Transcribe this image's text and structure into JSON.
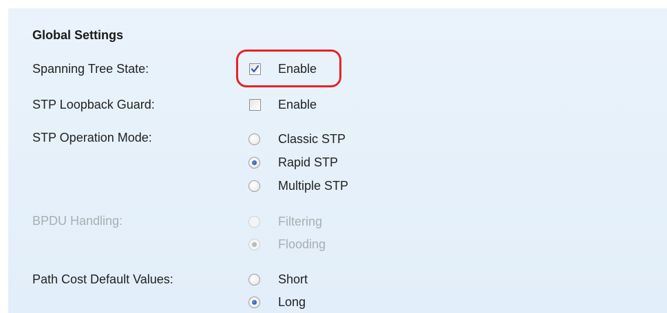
{
  "global_settings": {
    "title": "Global Settings",
    "spanning_tree_state": {
      "label": "Spanning Tree State:",
      "checkbox_label": "Enable",
      "checked": true
    },
    "stp_loopback_guard": {
      "label": "STP Loopback Guard:",
      "checkbox_label": "Enable",
      "checked": false
    },
    "stp_operation_mode": {
      "label": "STP Operation Mode:",
      "options": [
        "Classic STP",
        "Rapid STP",
        "Multiple STP"
      ],
      "selected": "Rapid STP"
    },
    "bpdu_handling": {
      "label": "BPDU Handling:",
      "disabled": true,
      "options": [
        "Filtering",
        "Flooding"
      ],
      "selected": "Flooding"
    },
    "path_cost_default_values": {
      "label": "Path Cost Default Values:",
      "options": [
        "Short",
        "Long"
      ],
      "selected": "Long"
    }
  },
  "colors": {
    "panel_background": "#e4eff9",
    "highlight_border": "#e8202a",
    "checkmark": "#2b5aa8",
    "disabled_text": "#a8aeb3"
  }
}
